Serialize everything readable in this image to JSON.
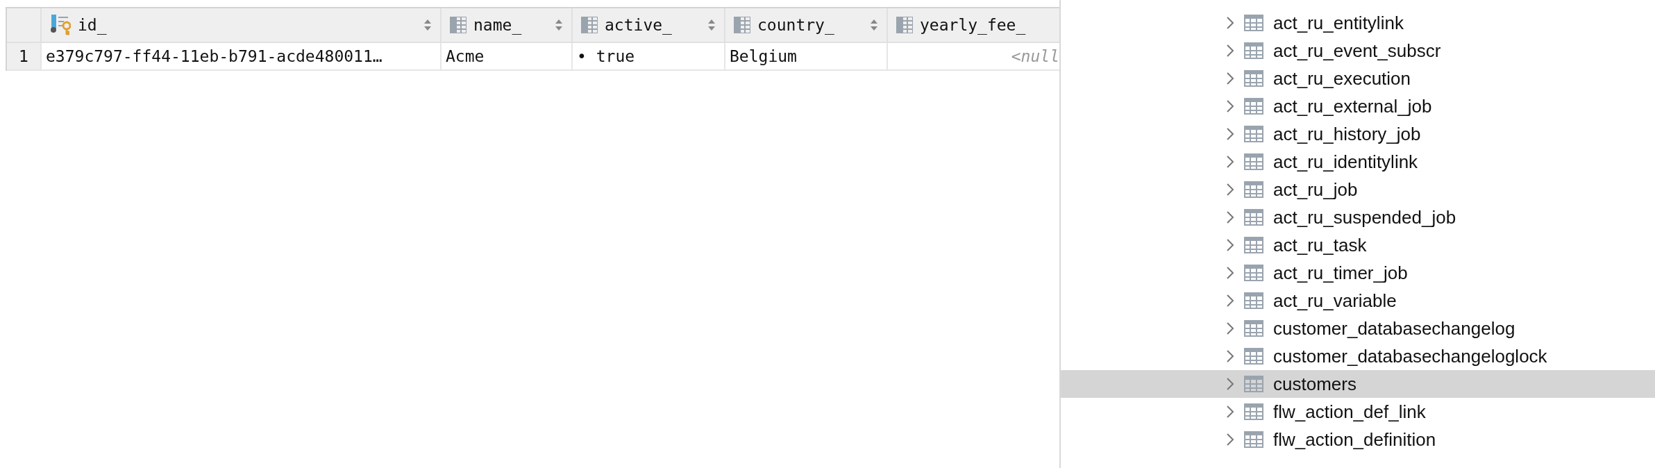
{
  "table": {
    "columns": [
      {
        "label": "id_",
        "kind": "key",
        "sortable": true
      },
      {
        "label": "name_",
        "kind": "column",
        "sortable": true
      },
      {
        "label": "active_",
        "kind": "column",
        "sortable": true
      },
      {
        "label": "country_",
        "kind": "column",
        "sortable": true
      },
      {
        "label": "yearly_fee_",
        "kind": "column",
        "sortable": false
      }
    ],
    "rows": [
      {
        "number": "1",
        "cells": [
          {
            "text": "e379c797-ff44-11eb-b791-acde480011…",
            "kind": "text"
          },
          {
            "text": "Acme",
            "kind": "text"
          },
          {
            "text": "• true",
            "kind": "text"
          },
          {
            "text": "Belgium",
            "kind": "text"
          },
          {
            "text": "<null",
            "kind": "null"
          }
        ]
      }
    ]
  },
  "tree": {
    "items": [
      {
        "label": "act_ru_entitylink",
        "selected": false
      },
      {
        "label": "act_ru_event_subscr",
        "selected": false
      },
      {
        "label": "act_ru_execution",
        "selected": false
      },
      {
        "label": "act_ru_external_job",
        "selected": false
      },
      {
        "label": "act_ru_history_job",
        "selected": false
      },
      {
        "label": "act_ru_identitylink",
        "selected": false
      },
      {
        "label": "act_ru_job",
        "selected": false
      },
      {
        "label": "act_ru_suspended_job",
        "selected": false
      },
      {
        "label": "act_ru_task",
        "selected": false
      },
      {
        "label": "act_ru_timer_job",
        "selected": false
      },
      {
        "label": "act_ru_variable",
        "selected": false
      },
      {
        "label": "customer_databasechangelog",
        "selected": false
      },
      {
        "label": "customer_databasechangeloglock",
        "selected": false
      },
      {
        "label": "customers",
        "selected": true
      },
      {
        "label": "flw_action_def_link",
        "selected": false
      },
      {
        "label": "flw_action_definition",
        "selected": false
      }
    ]
  }
}
